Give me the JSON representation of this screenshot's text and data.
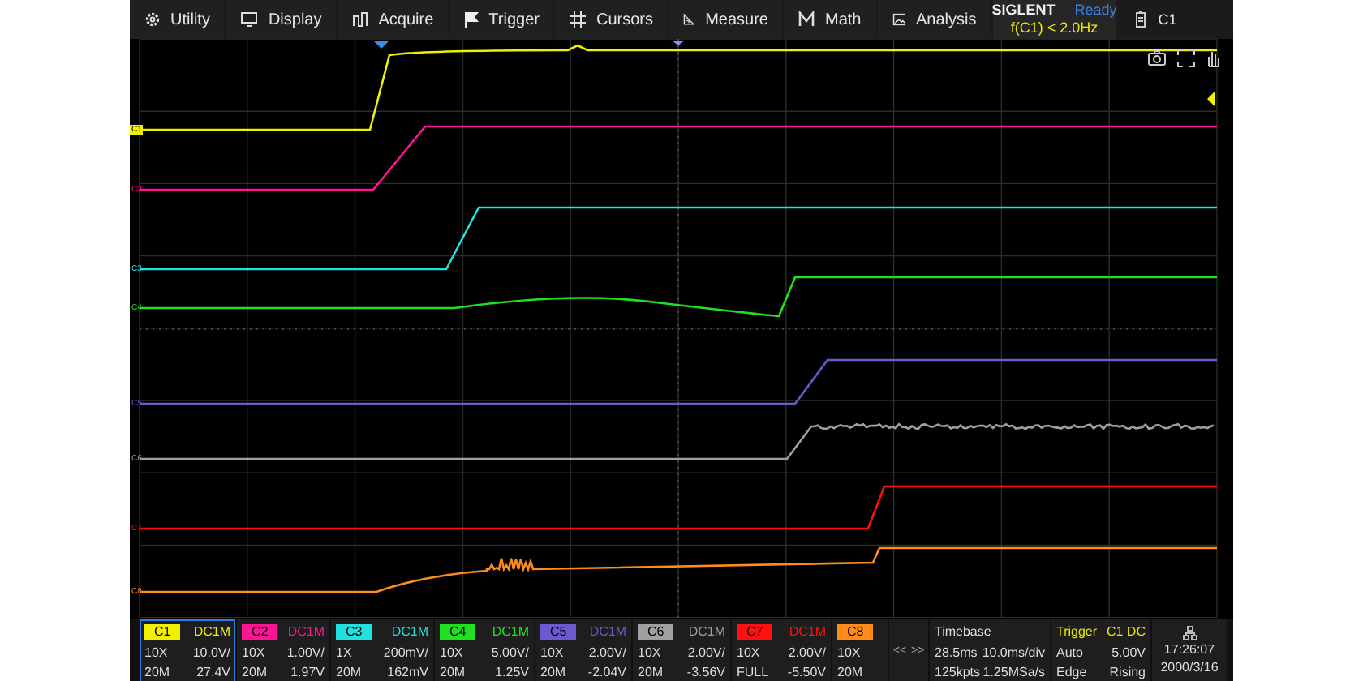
{
  "menu": {
    "items": [
      {
        "label": "Utility"
      },
      {
        "label": "Display"
      },
      {
        "label": "Acquire"
      },
      {
        "label": "Trigger"
      },
      {
        "label": "Cursors"
      },
      {
        "label": "Measure"
      },
      {
        "label": "Math"
      },
      {
        "label": "Analysis"
      }
    ],
    "brand": "SIGLENT",
    "status": "Ready",
    "measurement": "f(C1) < 2.0Hz",
    "active_channel": "C1"
  },
  "channels": [
    {
      "name": "C1",
      "marker": "C1",
      "color": "#f0f000",
      "selected": true,
      "coupling": "DC1M",
      "probe": "10X",
      "scale": "10.0V/",
      "bandwidth": "20M",
      "offset": "27.4V"
    },
    {
      "name": "C2",
      "marker": "C2",
      "color": "#ff1493",
      "selected": false,
      "coupling": "DC1M",
      "probe": "10X",
      "scale": "1.00V/",
      "bandwidth": "20M",
      "offset": "1.97V"
    },
    {
      "name": "C3",
      "marker": "C3",
      "color": "#20e0e0",
      "selected": false,
      "coupling": "DC1M",
      "probe": "1X",
      "scale": "200mV/",
      "bandwidth": "20M",
      "offset": "162mV"
    },
    {
      "name": "C4",
      "marker": "C4",
      "color": "#20e020",
      "selected": false,
      "coupling": "DC1M",
      "probe": "10X",
      "scale": "5.00V/",
      "bandwidth": "20M",
      "offset": "1.25V"
    },
    {
      "name": "C5",
      "marker": "C5",
      "color": "#6a5acd",
      "selected": false,
      "coupling": "DC1M",
      "probe": "10X",
      "scale": "2.00V/",
      "bandwidth": "20M",
      "offset": "-2.04V"
    },
    {
      "name": "C6",
      "marker": "C6",
      "color": "#a0a0a0",
      "selected": false,
      "coupling": "DC1M",
      "probe": "10X",
      "scale": "2.00V/",
      "bandwidth": "20M",
      "offset": "-3.56V"
    },
    {
      "name": "C7",
      "marker": "C7",
      "color": "#ff1010",
      "selected": false,
      "coupling": "DC1M",
      "probe": "10X",
      "scale": "2.00V/",
      "bandwidth": "FULL",
      "offset": "-5.50V"
    },
    {
      "name": "C8",
      "marker": "C8",
      "color": "#ff8c1a",
      "selected": false,
      "probe": "10X",
      "bandwidth": "20M"
    }
  ],
  "pager": [
    "<<",
    ">>"
  ],
  "timebase": {
    "title": "Timebase",
    "delay": "28.5ms",
    "scale": "10.0ms/div",
    "points": "125kpts",
    "sample_rate": "1.25MSa/s"
  },
  "trigger": {
    "title": "Trigger",
    "source": "C1 DC",
    "mode": "Auto",
    "level": "5.00V",
    "type": "Edge",
    "slope": "Rising"
  },
  "clock": {
    "time": "17:26:07",
    "date": "2000/3/16"
  }
}
